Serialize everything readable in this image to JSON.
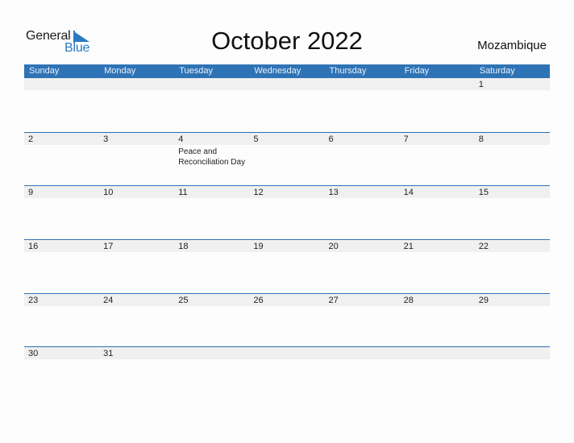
{
  "brand": {
    "line1": "General",
    "line2": "Blue",
    "accent": "#2a7ac0"
  },
  "title": "October 2022",
  "country": "Mozambique",
  "colors": {
    "header_bg": "#2e73b5",
    "date_strip": "#f0f0f0"
  },
  "weekdays": [
    "Sunday",
    "Monday",
    "Tuesday",
    "Wednesday",
    "Thursday",
    "Friday",
    "Saturday"
  ],
  "weeks": [
    {
      "days": [
        "",
        "",
        "",
        "",
        "",
        "",
        "1"
      ],
      "holidays": [
        "",
        "",
        "",
        "",
        "",
        "",
        ""
      ]
    },
    {
      "days": [
        "2",
        "3",
        "4",
        "5",
        "6",
        "7",
        "8"
      ],
      "holidays": [
        "",
        "",
        "Peace and Reconciliation Day",
        "",
        "",
        "",
        ""
      ]
    },
    {
      "days": [
        "9",
        "10",
        "11",
        "12",
        "13",
        "14",
        "15"
      ],
      "holidays": [
        "",
        "",
        "",
        "",
        "",
        "",
        ""
      ]
    },
    {
      "days": [
        "16",
        "17",
        "18",
        "19",
        "20",
        "21",
        "22"
      ],
      "holidays": [
        "",
        "",
        "",
        "",
        "",
        "",
        ""
      ]
    },
    {
      "days": [
        "23",
        "24",
        "25",
        "26",
        "27",
        "28",
        "29"
      ],
      "holidays": [
        "",
        "",
        "",
        "",
        "",
        "",
        ""
      ]
    },
    {
      "days": [
        "30",
        "31",
        "",
        "",
        "",
        "",
        ""
      ],
      "holidays": [
        "",
        "",
        "",
        "",
        "",
        "",
        ""
      ]
    }
  ]
}
